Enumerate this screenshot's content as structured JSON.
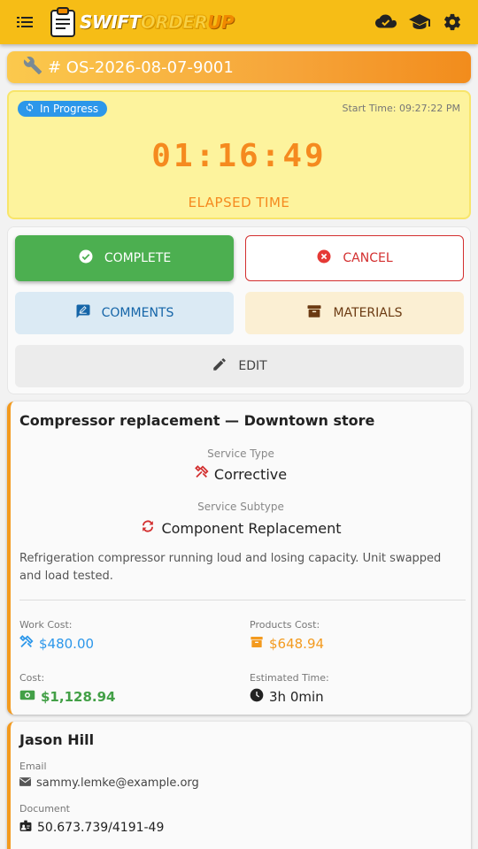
{
  "app": {
    "logo": {
      "part1": "SWIFT",
      "part2": "Order",
      "part3": "UP"
    }
  },
  "header": {
    "icons": [
      "menu-icon",
      "cloud-done-icon",
      "graduation-cap-icon",
      "gear-icon"
    ]
  },
  "order": {
    "number": "# OS-2026-08-07-9001"
  },
  "timer": {
    "status": "In Progress",
    "start_time": "Start Time: 09:27:22 PM",
    "elapsed": "01:16:49",
    "elapsed_label": "ELAPSED TIME"
  },
  "actions": {
    "complete": "COMPLETE",
    "cancel": "CANCEL",
    "comments": "COMMENTS",
    "materials": "MATERIALS",
    "edit": "EDIT"
  },
  "details": {
    "title": "Compressor replacement — Downtown store",
    "service_type_label": "Service Type",
    "service_type": "Corrective",
    "service_subtype_label": "Service Subtype",
    "service_subtype": "Component Replacement",
    "description": "Refrigeration compressor running loud and losing capacity. Unit swapped and load tested.",
    "work_cost_label": "Work Cost:",
    "work_cost": "$480.00",
    "products_cost_label": "Products Cost:",
    "products_cost": "$648.94",
    "cost_label": "Cost:",
    "cost": "$1,128.94",
    "estimated_time_label": "Estimated Time:",
    "estimated_time": "3h 0min"
  },
  "client": {
    "name": "Jason Hill",
    "email_label": "Email",
    "email": "sammy.lemke@example.org",
    "document_label": "Document",
    "document": "50.673.739/4191-49"
  },
  "colors": {
    "header": "#f6bd16",
    "accent_orange": "#f58a1f",
    "complete_green": "#4caf50",
    "cancel_red": "#d32f2f",
    "status_blue": "#2c97ea",
    "money_blue": "#2c97ea",
    "money_orange": "#f39a1e",
    "money_green": "#4caf50"
  }
}
